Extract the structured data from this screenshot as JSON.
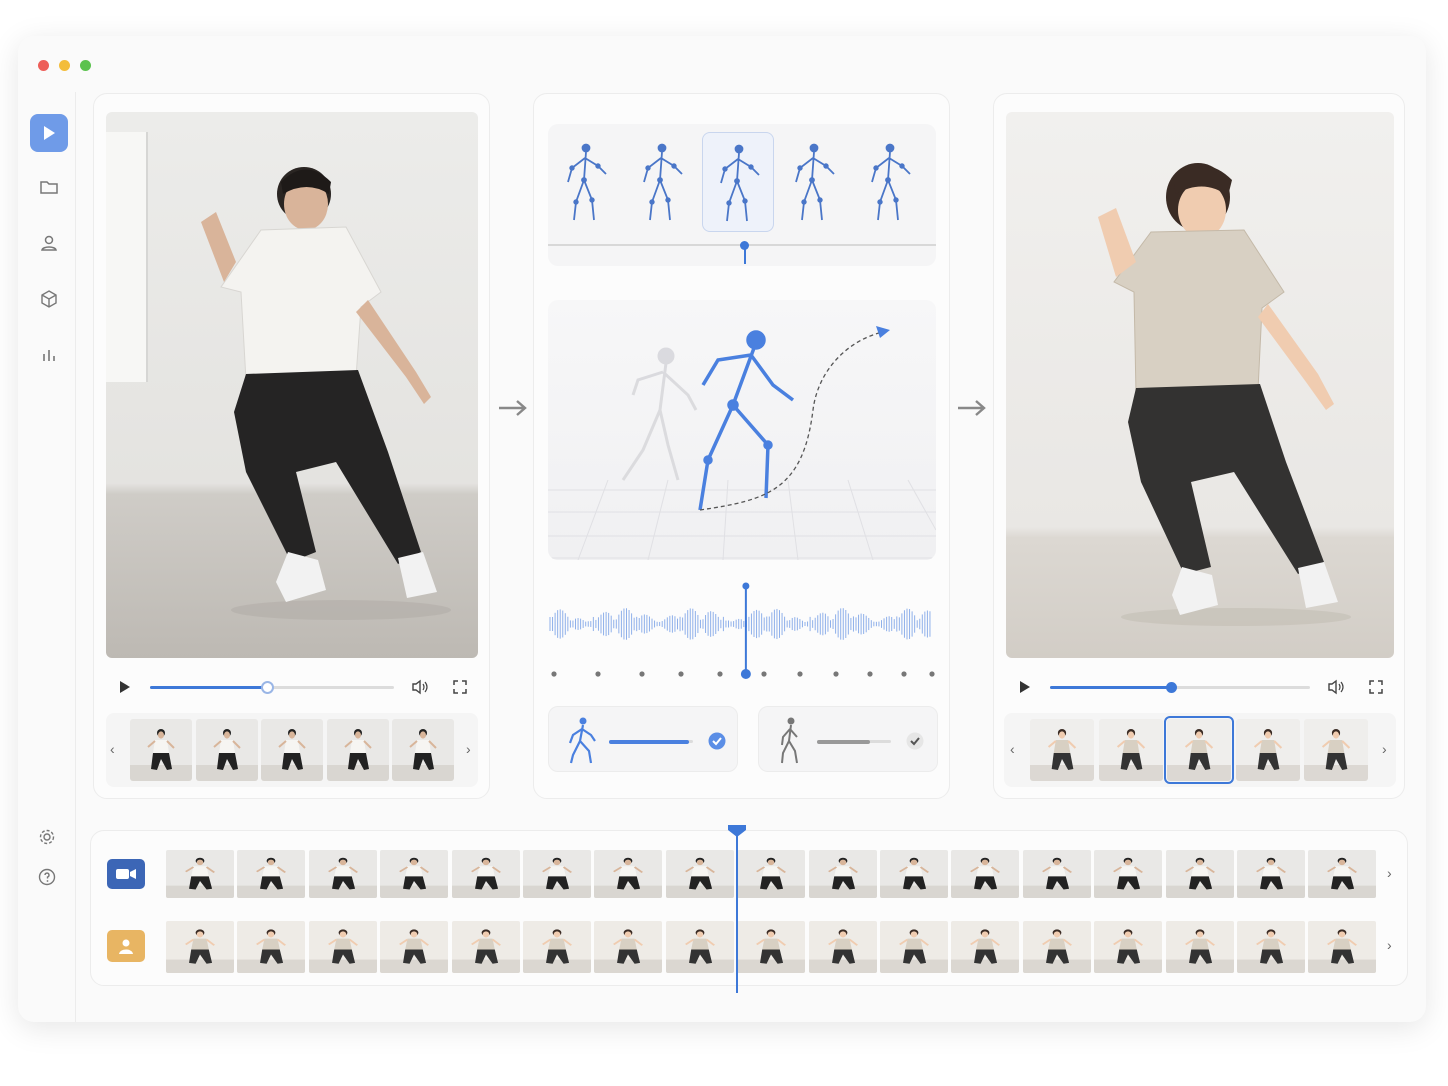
{
  "window": {
    "controls": [
      "close",
      "minimize",
      "maximize"
    ]
  },
  "colors": {
    "accent": "#3d78d8",
    "close": "#ed5e58",
    "minimize": "#f3bd3b",
    "maximize": "#5bc24e",
    "track_video": "#3c66b6",
    "track_avatar": "#e8b563"
  },
  "sidebar": {
    "items": [
      {
        "icon": "play-icon",
        "active": true
      },
      {
        "icon": "folder-icon"
      },
      {
        "icon": "user-icon"
      },
      {
        "icon": "cube-icon"
      },
      {
        "icon": "bar-chart-icon"
      }
    ],
    "bottom": [
      {
        "icon": "gear-icon"
      },
      {
        "icon": "help-icon"
      }
    ]
  },
  "source_panel": {
    "progress": 0.48,
    "thumbnails": 5
  },
  "pose_panel": {
    "poses": 5,
    "selected_pose": 3,
    "waveform_playhead": 0.51,
    "motion_slider": 0.95,
    "ghost_slider": 0.72
  },
  "output_panel": {
    "progress": 0.47,
    "thumbnails": 5,
    "selected_thumb": 3
  },
  "timeline": {
    "playhead": 0.47,
    "tracks": [
      {
        "icon": "video-camera-icon",
        "frames": 17
      },
      {
        "icon": "avatar-icon",
        "frames": 17
      }
    ]
  }
}
